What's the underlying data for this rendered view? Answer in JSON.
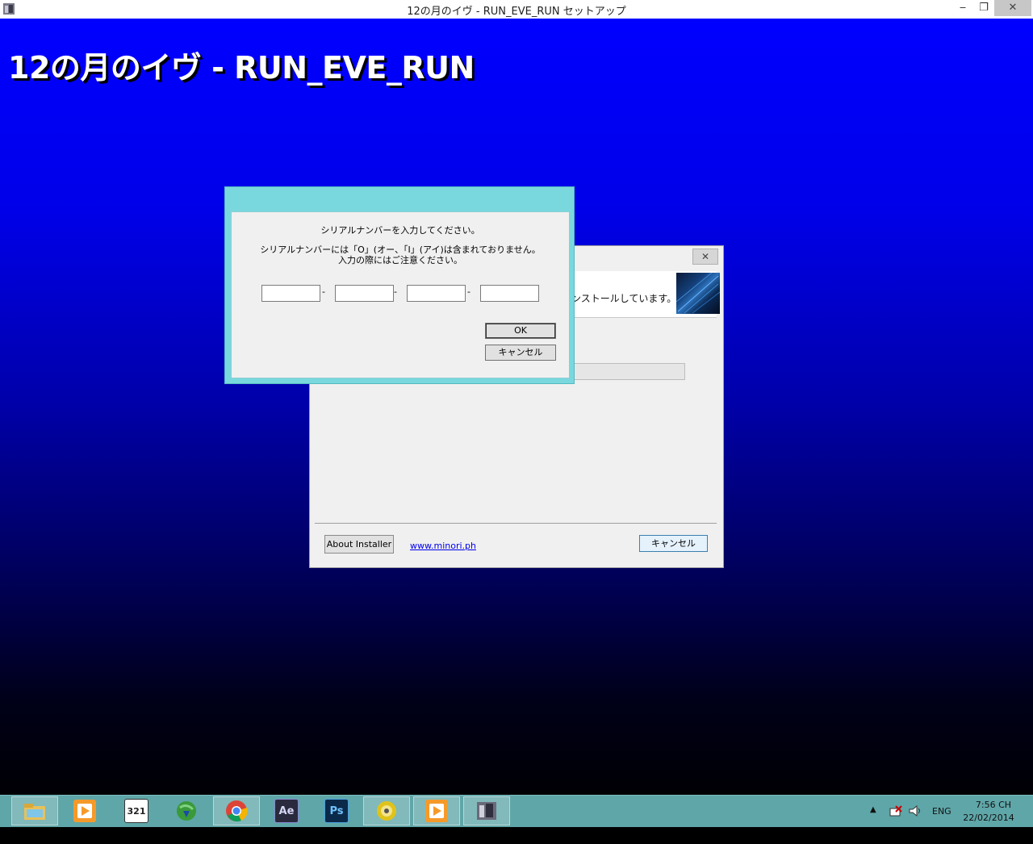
{
  "window": {
    "title": "12の月のイヴ - RUN_EVE_RUN セットアップ",
    "controls": {
      "minimize": "‒",
      "maximize": "❐",
      "close": "✕"
    }
  },
  "desktop": {
    "big_title": "12の月のイヴ - RUN_EVE_RUN"
  },
  "installer": {
    "close": "✕",
    "header_text": "ンストールしています。",
    "about_label": "About Installer",
    "link_text": "www.minori.ph",
    "cancel_label": "キャンセル"
  },
  "serial_dialog": {
    "line1": "シリアルナンバーを入力してください。",
    "line2": "シリアルナンバーには「O」(オー、「I」(アイ)は含まれておりません。",
    "line3": "入力の際にはご注意ください。",
    "separator": "-",
    "fields": [
      "",
      "",
      "",
      ""
    ],
    "ok_label": "OK",
    "cancel_label": "キャンセル"
  },
  "taskbar": {
    "items": [
      {
        "name": "file-explorer",
        "label": ""
      },
      {
        "name": "media-player",
        "label": ""
      },
      {
        "name": "media-player-classic",
        "label": "321"
      },
      {
        "name": "internet-download-manager",
        "label": ""
      },
      {
        "name": "chrome",
        "label": ""
      },
      {
        "name": "after-effects",
        "label": "Ae"
      },
      {
        "name": "photoshop",
        "label": "Ps"
      },
      {
        "name": "disc-tool",
        "label": ""
      },
      {
        "name": "media-player-2",
        "label": ""
      },
      {
        "name": "installer-app",
        "label": ""
      }
    ],
    "tray": {
      "language": "ENG",
      "time": "7:56 CH",
      "date": "22/02/2014"
    }
  }
}
